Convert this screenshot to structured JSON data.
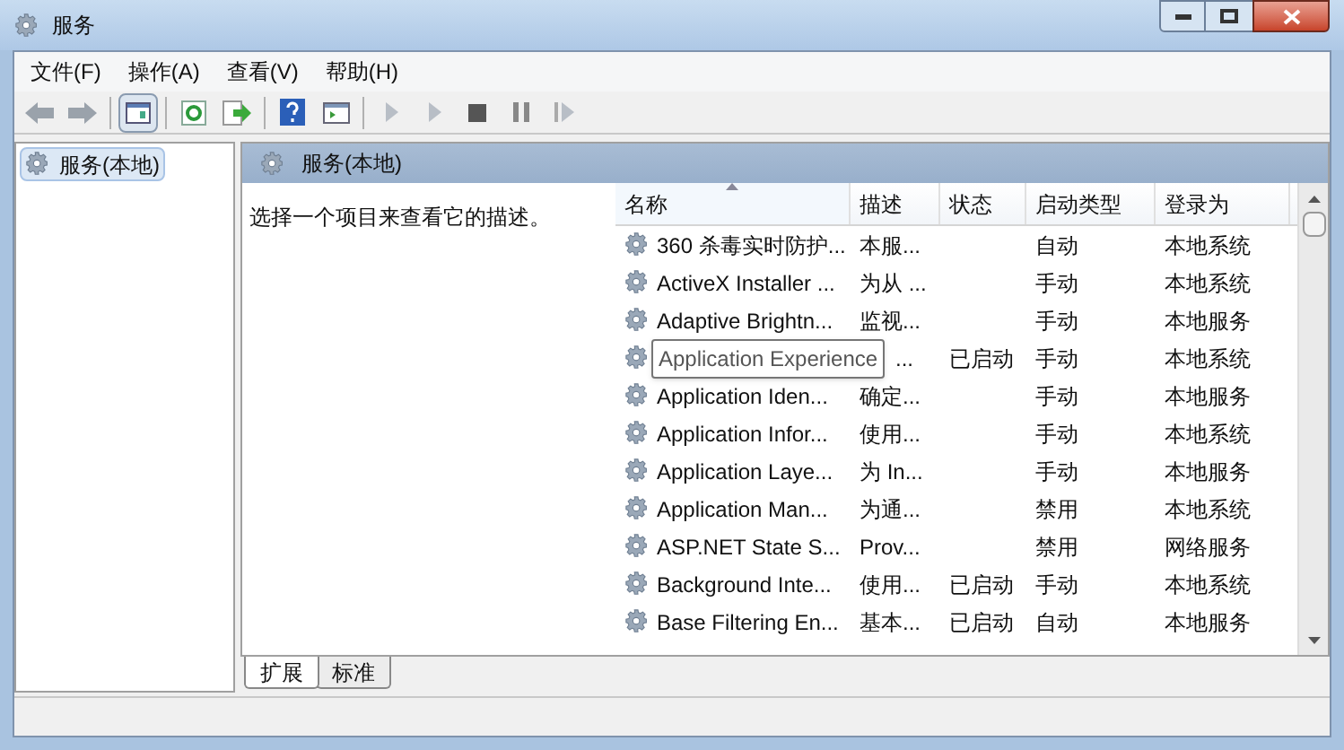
{
  "window": {
    "title": "服务"
  },
  "menu": [
    "文件(F)",
    "操作(A)",
    "查看(V)",
    "帮助(H)"
  ],
  "tree": {
    "items": [
      {
        "label": "服务(本地)",
        "selected": true
      }
    ]
  },
  "pane": {
    "title": "服务(本地)",
    "description": "选择一个项目来查看它的描述。"
  },
  "table": {
    "columns": [
      {
        "label": "名称",
        "sorted": true
      },
      {
        "label": "描述",
        "sorted": false
      },
      {
        "label": "状态",
        "sorted": false
      },
      {
        "label": "启动类型",
        "sorted": false
      },
      {
        "label": "登录为",
        "sorted": false
      }
    ],
    "rows": [
      {
        "name": "360 杀毒实时防护...",
        "desc": "本服...",
        "startup": "自动",
        "logon": "本地系统"
      },
      {
        "name": "ActiveX Installer ...",
        "desc": "为从 ...",
        "startup": "手动",
        "logon": "本地系统"
      },
      {
        "name": "Adaptive Brightn...",
        "desc": "监视...",
        "startup": "手动",
        "logon": "本地服务"
      },
      {
        "desc": "...",
        "status": "已启动",
        "startup": "手动",
        "logon": "本地系统"
      },
      {
        "name": "Application Iden...",
        "desc": "确定...",
        "startup": "手动",
        "logon": "本地服务"
      },
      {
        "name": "Application Infor...",
        "desc": "使用...",
        "startup": "手动",
        "logon": "本地系统"
      },
      {
        "name": "Application Laye...",
        "desc": "为 In...",
        "startup": "手动",
        "logon": "本地服务"
      },
      {
        "name": "Application Man...",
        "desc": "为通...",
        "startup": "禁用",
        "logon": "本地系统"
      },
      {
        "name": "ASP.NET State S...",
        "desc": "Prov...",
        "startup": "禁用",
        "logon": "网络服务"
      },
      {
        "name": "Background Inte...",
        "desc": "使用...",
        "status": "已启动",
        "startup": "手动",
        "logon": "本地系统"
      },
      {
        "name": "Base Filtering En...",
        "desc": "基本...",
        "status": "已启动",
        "startup": "自动",
        "logon": "本地服务"
      }
    ]
  },
  "tooltip": "Application Experience",
  "tabs": [
    {
      "label": "扩展",
      "selected": true
    },
    {
      "label": "标准",
      "selected": false
    }
  ]
}
